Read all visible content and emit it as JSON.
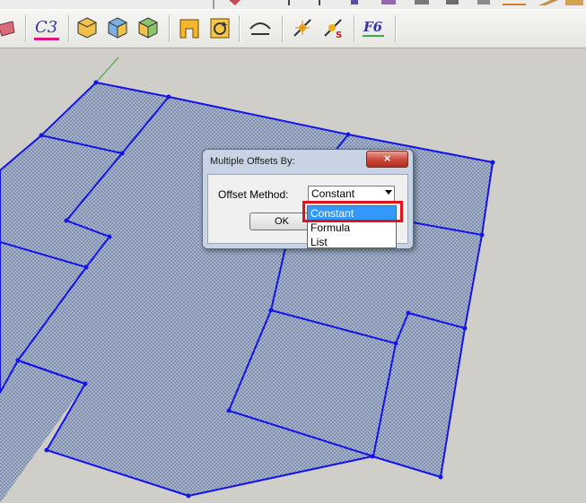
{
  "toolbar": {
    "icons": [
      "partial-red-icon",
      "c3-icon",
      "hexagon-orange-icon",
      "hexagon-blue-icon",
      "hexagon-green-icon",
      "gate-icon",
      "rotate-frame-icon",
      "arc-offset-icon",
      "line-spark-icon",
      "line-spark-s-icon",
      "f6-icon"
    ],
    "c3_label": "C3",
    "f6_label": "F6",
    "s_label": "S"
  },
  "dialog": {
    "title": "Multiple Offsets By:",
    "close_label": "×",
    "method_label": "Offset Method:",
    "method_value": "Constant",
    "ok_label": "OK"
  },
  "dropdown": {
    "options": [
      "Constant",
      "Formula",
      "List"
    ],
    "selected": "Constant"
  },
  "colors": {
    "surface_fill": "#a7b4cc",
    "edge_blue": "#0000ee",
    "highlight_red": "#e0131d",
    "selection_blue": "#3399ff",
    "background": "#cfcec9"
  }
}
